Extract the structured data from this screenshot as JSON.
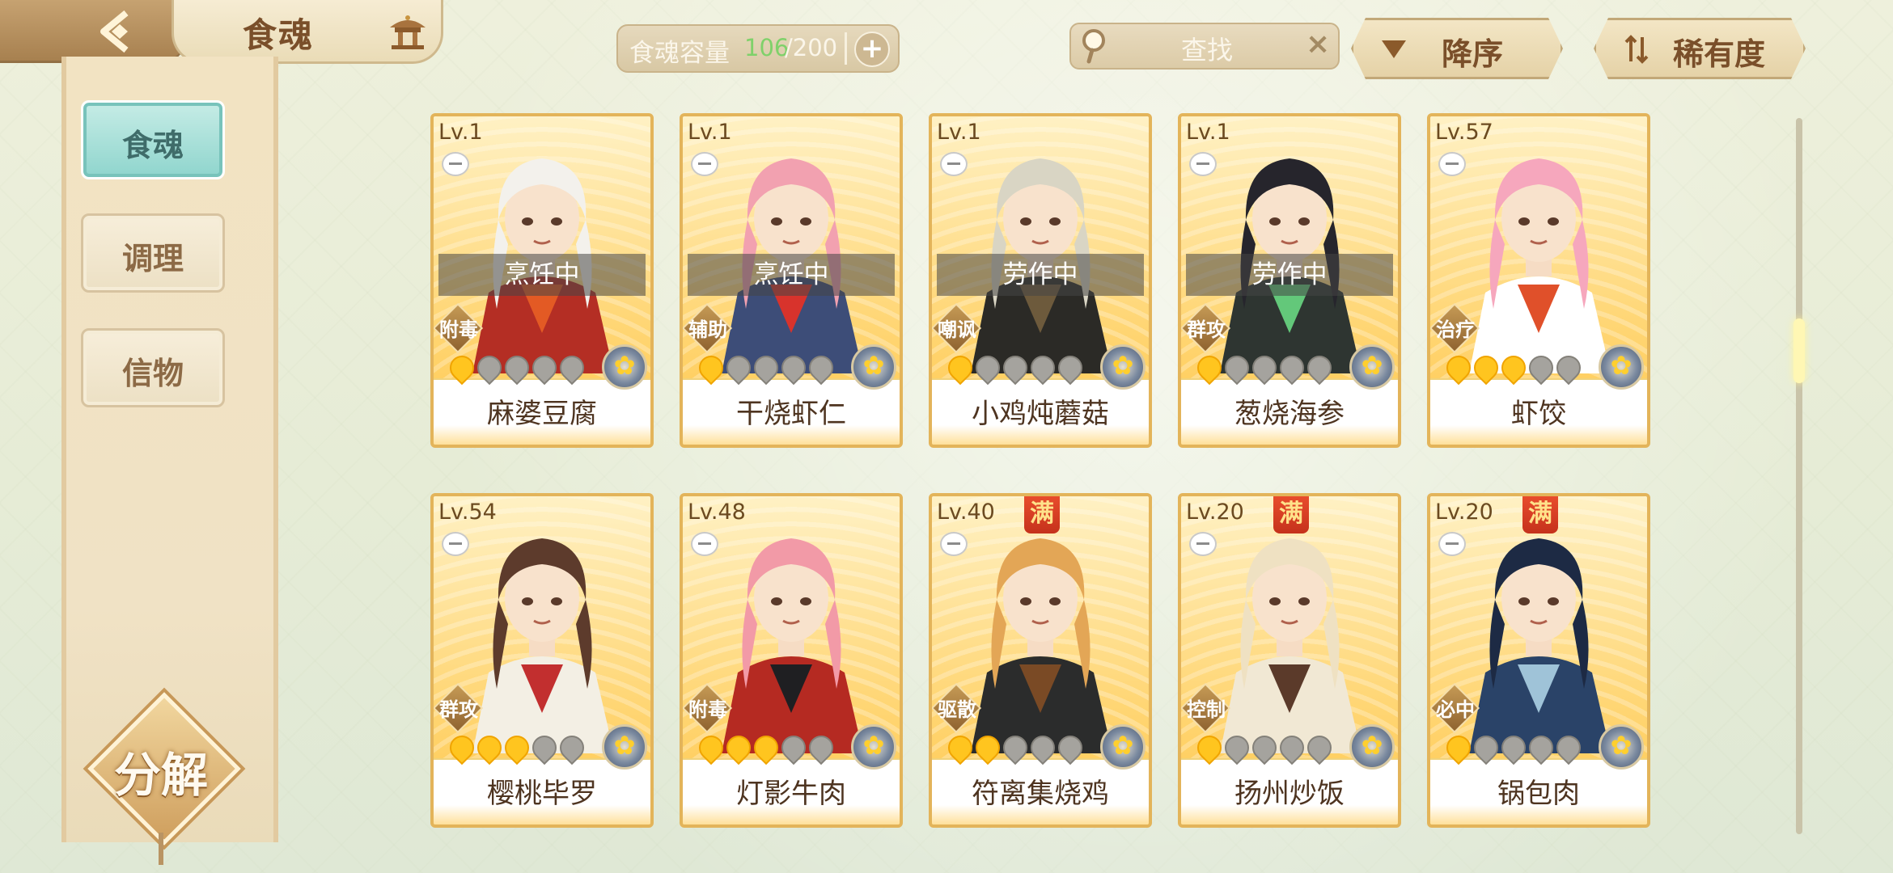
{
  "header": {
    "title": "食魂",
    "capacity_label": "食魂容量",
    "capacity_current": "106",
    "capacity_max": "/200",
    "capacity_add": "+",
    "search_placeholder": "查找",
    "search_clear": "×",
    "sort_order_label": "降序",
    "sort_rarity_label": "稀有度"
  },
  "sidebar": {
    "tabs": [
      {
        "label": "食魂",
        "active": true
      },
      {
        "label": "调理",
        "active": false
      },
      {
        "label": "信物",
        "active": false
      }
    ],
    "decompose_label": "分解"
  },
  "cards": [
    {
      "level": "Lv.1",
      "name": "麻婆豆腐",
      "status": "烹饪中",
      "role": "附毒",
      "stars": 1,
      "max_stars": 5,
      "full": false,
      "hair": "#f3f1ec",
      "outfit": "#b42e24",
      "accent": "#e35a24"
    },
    {
      "level": "Lv.1",
      "name": "干烧虾仁",
      "status": "烹饪中",
      "role": "辅助",
      "stars": 1,
      "max_stars": 5,
      "full": false,
      "hair": "#f2a1b0",
      "outfit": "#3d4d78",
      "accent": "#d8332c"
    },
    {
      "level": "Lv.1",
      "name": "小鸡炖蘑菇",
      "status": "劳作中",
      "role": "嘲讽",
      "stars": 1,
      "max_stars": 5,
      "full": false,
      "hair": "#d9d5c4",
      "outfit": "#2b2a26",
      "accent": "#6d5a3c"
    },
    {
      "level": "Lv.1",
      "name": "葱烧海参",
      "status": "劳作中",
      "role": "群攻",
      "stars": 1,
      "max_stars": 5,
      "full": false,
      "hair": "#26252c",
      "outfit": "#2e3531",
      "accent": "#63c87a"
    },
    {
      "level": "Lv.57",
      "name": "虾饺",
      "status": "",
      "role": "治疗",
      "stars": 3,
      "max_stars": 5,
      "full": false,
      "hair": "#f6a7bd",
      "outfit": "#ffffff",
      "accent": "#e0502a"
    },
    {
      "level": "Lv.54",
      "name": "樱桃毕罗",
      "status": "",
      "role": "群攻",
      "stars": 3,
      "max_stars": 5,
      "full": false,
      "hair": "#5d3b2c",
      "outfit": "#f3efe4",
      "accent": "#c22f2f"
    },
    {
      "level": "Lv.48",
      "name": "灯影牛肉",
      "status": "",
      "role": "附毒",
      "stars": 3,
      "max_stars": 5,
      "full": false,
      "hair": "#f29aa7",
      "outfit": "#b52a22",
      "accent": "#1f1f22"
    },
    {
      "level": "Lv.40",
      "name": "符离集烧鸡",
      "status": "",
      "role": "驱散",
      "stars": 2,
      "max_stars": 5,
      "full": true,
      "hair": "#e3a656",
      "outfit": "#2b2c2c",
      "accent": "#7a4a25"
    },
    {
      "level": "Lv.20",
      "name": "扬州炒饭",
      "status": "",
      "role": "控制",
      "stars": 1,
      "max_stars": 5,
      "full": true,
      "hair": "#efe1c2",
      "outfit": "#f1e8d4",
      "accent": "#5b3a2a"
    },
    {
      "level": "Lv.20",
      "name": "锅包肉",
      "status": "",
      "role": "必中",
      "stars": 1,
      "max_stars": 5,
      "full": true,
      "hair": "#1d2a44",
      "outfit": "#2a4368",
      "accent": "#9fc3d8"
    }
  ],
  "full_badge_label": "满"
}
